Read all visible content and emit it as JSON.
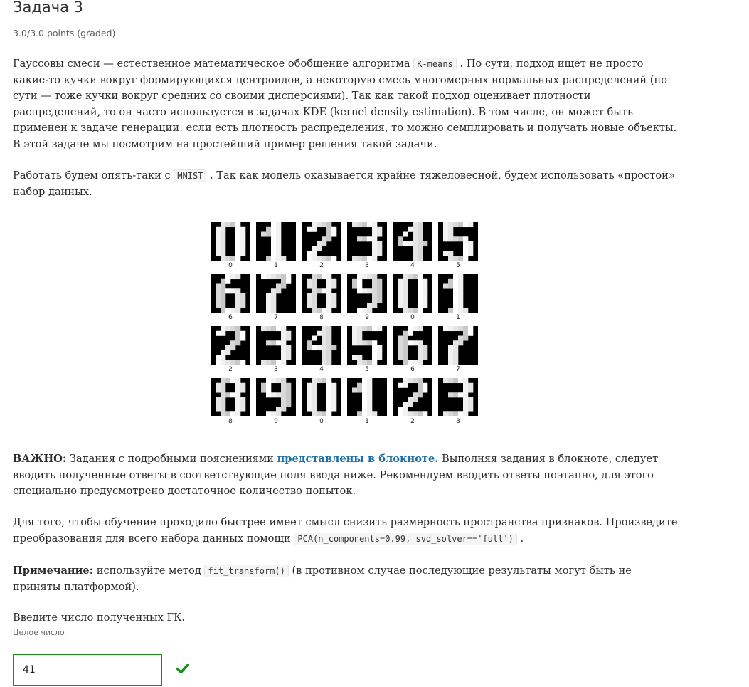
{
  "problem": {
    "title": "Задача 3",
    "points": "3.0/3.0 points (graded)"
  },
  "paragraph1": {
    "t1": "Гауссовы смеси — естественное математическое обобщение алгоритма ",
    "code": "K-means",
    "t2": " . По сути, подход ищет не просто какие-то кучки вокруг формирующихся центроидов, а некоторую смесь многомерных нормальных распределений (по сути — тоже кучки вокруг средних со своими дисперсиями). Так как такой подход оценивает плотности распределений, то он часто используется в задачах KDE (kernel density estimation). В том числе, он может быть применен к задаче генерации: если есть плотность распределения, то можно семплировать и получать новые объекты. В этой задаче мы посмотрим на простейший пример решения такой задачи."
  },
  "paragraph2": {
    "t1": "Работать будем опять-таки с ",
    "code": "MNIST",
    "t2": " . Так как модель оказывается крайне тяжеловесной, будем использовать «простой» набор данных."
  },
  "digit_labels": [
    "0",
    "1",
    "2",
    "3",
    "4",
    "5",
    "6",
    "7",
    "8",
    "9",
    "0",
    "1",
    "2",
    "3",
    "4",
    "5",
    "6",
    "7",
    "8",
    "9",
    "0",
    "1",
    "2",
    "3"
  ],
  "important": {
    "bold": "ВАЖНО:",
    "t1": " Задания с подробными пояснениями ",
    "link": "представлены в блокноте.",
    "t2": " Выполняя задания в блокноте, следует вводить полученные ответы в соответствующие поля ввода ниже. Рекомендуем вводить ответы поэтапно, для этого специально предусмотрено достаточное количество попыток."
  },
  "paragraph4": {
    "t1": "Для того, чтобы обучение проходило быстрее имеет смысл снизить размерность пространства признаков. Произведите преобразования для всего набора данных помощи ",
    "code": "PCA(n_components=0.99, svd_solver=='full')",
    "t2": " ."
  },
  "note": {
    "bold": "Примечание:",
    "t1": " используйте метод ",
    "code": "fit_transform()",
    "t2": " (в противном случае последующие результаты могут быть не приняты платформой)."
  },
  "answer": {
    "label": "Введите число полученных ГК.",
    "hint": "Целое число",
    "value": "41",
    "status_icon": "check-icon",
    "status_color": "#198c19"
  }
}
